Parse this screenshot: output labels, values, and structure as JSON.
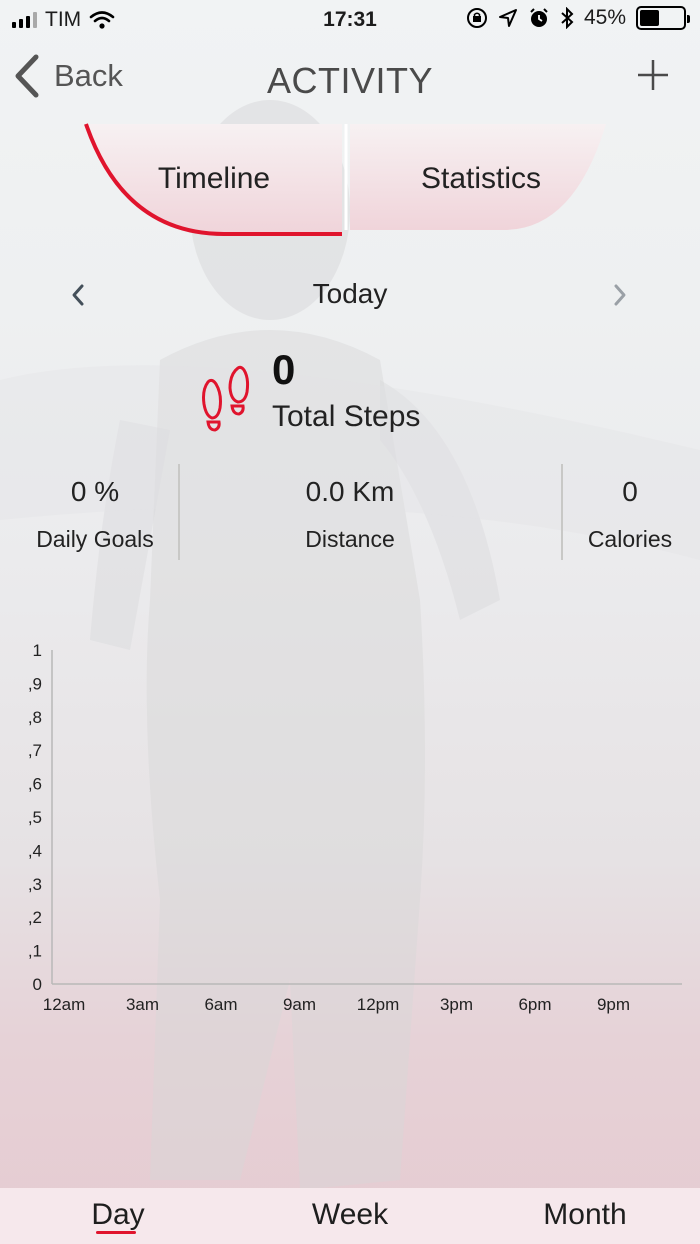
{
  "status_bar": {
    "carrier": "TIM",
    "time": "17:31",
    "battery_percent": "45%",
    "battery_level": 0.45,
    "icons": [
      "signal-icon",
      "wifi-icon",
      "orientation-lock-icon",
      "location-icon",
      "alarm-icon",
      "bluetooth-icon",
      "battery-icon"
    ]
  },
  "nav": {
    "back_label": "Back",
    "title": "ACTIVITY",
    "add_icon": "plus-icon"
  },
  "tabs": [
    {
      "label": "Timeline",
      "selected": true
    },
    {
      "label": "Statistics",
      "selected": false
    }
  ],
  "date_selector": {
    "label": "Today",
    "prev_icon": "chevron-left-icon",
    "next_icon": "chevron-right-icon"
  },
  "steps": {
    "value": "0",
    "label": "Total Steps",
    "icon": "footprints-icon"
  },
  "stats": {
    "daily_goals": {
      "value": "0 %",
      "label": "Daily Goals"
    },
    "distance": {
      "value": "0.0 Km",
      "label": "Distance"
    },
    "calories": {
      "value": "0",
      "label": "Calories"
    }
  },
  "chart_data": {
    "type": "bar",
    "categories": [
      "12am",
      "3am",
      "6am",
      "9am",
      "12pm",
      "3pm",
      "6pm",
      "9pm"
    ],
    "values": [
      0,
      0,
      0,
      0,
      0,
      0,
      0,
      0
    ],
    "y_tick_labels": [
      "0",
      ",1",
      ",2",
      ",3",
      ",4",
      ",5",
      ",6",
      ",7",
      ",8",
      ",9",
      "1"
    ],
    "ylim": [
      0,
      1
    ],
    "grid": false,
    "title": "",
    "xlabel": "",
    "ylabel": ""
  },
  "periods": [
    {
      "label": "Day",
      "selected": true
    },
    {
      "label": "Week",
      "selected": false
    },
    {
      "label": "Month",
      "selected": false
    }
  ],
  "colors": {
    "accent": "#e0142d",
    "tab_fill": "#f3dde1",
    "divider": "#c8c8c6"
  }
}
